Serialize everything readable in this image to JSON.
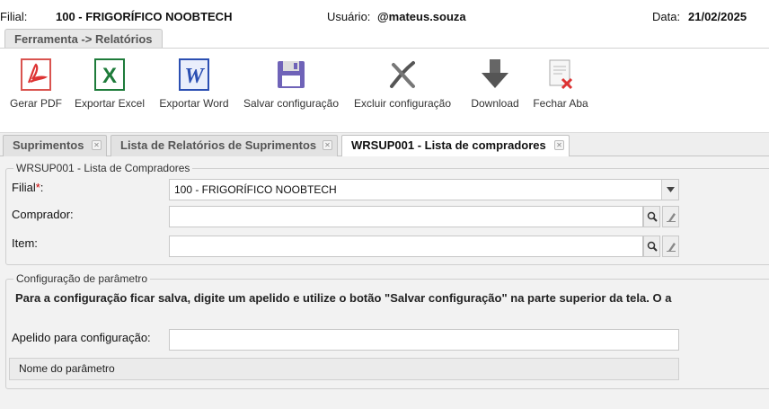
{
  "header": {
    "branch_label": "Filial:",
    "branch_value": "100 - FRIGORÍFICO NOOBTECH",
    "user_label": "Usuário:",
    "user_value": "@mateus.souza",
    "date_label": "Data:",
    "date_value": "21/02/2025"
  },
  "tool_tab": "Ferramenta -> Relatórios",
  "toolbar": {
    "pdf": "Gerar PDF",
    "excel": "Exportar Excel",
    "word": "Exportar Word",
    "save": "Salvar configuração",
    "delete": "Excluir configuração",
    "download": "Download",
    "close": "Fechar Aba"
  },
  "tabs": [
    {
      "label": "Suprimentos"
    },
    {
      "label": "Lista de Relatórios de Suprimentos"
    },
    {
      "label": "WRSUP001 - Lista de compradores"
    }
  ],
  "form": {
    "legend": "WRSUP001 - Lista de Compradores",
    "branch_label": "Filial",
    "required_mark": "*",
    "branch_colon": ":",
    "branch_value": "100 - FRIGORÍFICO NOOBTECH",
    "buyer_label": "Comprador:",
    "buyer_value": "",
    "item_label": "Item:",
    "item_value": ""
  },
  "config": {
    "legend": "Configuração de parâmetro",
    "info": "Para a configuração ficar salva, digite um apelido e utilize o botão \"Salvar configuração\" na parte superior da tela.  O a",
    "nickname_label": "Apelido para configuração:",
    "nickname_value": "",
    "grid_header": "Nome do parâmetro"
  }
}
